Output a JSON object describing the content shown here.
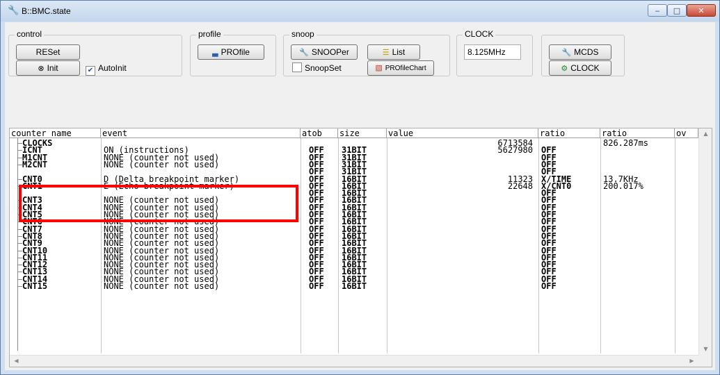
{
  "window": {
    "title": "B::BMC.state",
    "min_glyph": "‒",
    "max_glyph": "□",
    "close_glyph": "✕"
  },
  "control": {
    "label": "control",
    "reset": "RESet",
    "init": "Init",
    "autoinit": "AutoInit",
    "autoinit_checked": true
  },
  "profile": {
    "label": "profile",
    "button": "PROfile"
  },
  "snoop": {
    "label": "snoop",
    "snooper": "SNOOPer",
    "list": "List",
    "snoopset": "SnoopSet",
    "snoopset_checked": false,
    "profilechart": "PROfileChart"
  },
  "clock": {
    "label": "CLOCK",
    "value": "8.125MHz"
  },
  "extra": {
    "mcds": "MCDS",
    "clock_button": "CLOCK"
  },
  "table": {
    "headers": [
      "counter name",
      "event",
      "atob",
      "size",
      "value",
      "ratio",
      "ratio",
      "ov"
    ],
    "rows": [
      {
        "name": "CLOCKS",
        "event": "",
        "atob": "",
        "size": "",
        "value": "6713584",
        "ratio1": "",
        "ratio2": "826.287ms"
      },
      {
        "name": "ICNT",
        "event": "ON (instructions)",
        "atob": "OFF",
        "size": "31BIT",
        "value": "5627980",
        "ratio1": "OFF",
        "ratio2": ""
      },
      {
        "name": "M1CNT",
        "event": "NONE (counter not used)",
        "atob": "OFF",
        "size": "31BIT",
        "value": "",
        "ratio1": "OFF",
        "ratio2": ""
      },
      {
        "name": "M2CNT",
        "event": "NONE (counter not used)",
        "atob": "OFF",
        "size": "31BIT",
        "value": "",
        "ratio1": "OFF",
        "ratio2": ""
      },
      {
        "name": "",
        "event": "",
        "atob": "OFF",
        "size": "31BIT",
        "value": "",
        "ratio1": "OFF",
        "ratio2": ""
      },
      {
        "name": "CNT0",
        "event": "D (Delta breakpoint marker)",
        "atob": "OFF",
        "size": "16BIT",
        "value": "11323",
        "ratio1": "X/TIME",
        "ratio2": "13.7KHz"
      },
      {
        "name": "CNT1",
        "event": "E (Echo breakpoint marker)",
        "atob": "OFF",
        "size": "16BIT",
        "value": "22648",
        "ratio1": "X/CNT0",
        "ratio2": "200.017%"
      },
      {
        "name": "",
        "event": "",
        "atob": "OFF",
        "size": "16BIT",
        "value": "",
        "ratio1": "OFF",
        "ratio2": ""
      },
      {
        "name": "CNT3",
        "event": "NONE (counter not used)",
        "atob": "OFF",
        "size": "16BIT",
        "value": "",
        "ratio1": "OFF",
        "ratio2": ""
      },
      {
        "name": "CNT4",
        "event": "NONE (counter not used)",
        "atob": "OFF",
        "size": "16BIT",
        "value": "",
        "ratio1": "OFF",
        "ratio2": ""
      },
      {
        "name": "CNT5",
        "event": "NONE (counter not used)",
        "atob": "OFF",
        "size": "16BIT",
        "value": "",
        "ratio1": "OFF",
        "ratio2": ""
      },
      {
        "name": "CNT6",
        "event": "NONE (counter not used)",
        "atob": "OFF",
        "size": "16BIT",
        "value": "",
        "ratio1": "OFF",
        "ratio2": ""
      },
      {
        "name": "CNT7",
        "event": "NONE (counter not used)",
        "atob": "OFF",
        "size": "16BIT",
        "value": "",
        "ratio1": "OFF",
        "ratio2": ""
      },
      {
        "name": "CNT8",
        "event": "NONE (counter not used)",
        "atob": "OFF",
        "size": "16BIT",
        "value": "",
        "ratio1": "OFF",
        "ratio2": ""
      },
      {
        "name": "CNT9",
        "event": "NONE (counter not used)",
        "atob": "OFF",
        "size": "16BIT",
        "value": "",
        "ratio1": "OFF",
        "ratio2": ""
      },
      {
        "name": "CNT10",
        "event": "NONE (counter not used)",
        "atob": "OFF",
        "size": "16BIT",
        "value": "",
        "ratio1": "OFF",
        "ratio2": ""
      },
      {
        "name": "CNT11",
        "event": "NONE (counter not used)",
        "atob": "OFF",
        "size": "16BIT",
        "value": "",
        "ratio1": "OFF",
        "ratio2": ""
      },
      {
        "name": "CNT12",
        "event": "NONE (counter not used)",
        "atob": "OFF",
        "size": "16BIT",
        "value": "",
        "ratio1": "OFF",
        "ratio2": ""
      },
      {
        "name": "CNT13",
        "event": "NONE (counter not used)",
        "atob": "OFF",
        "size": "16BIT",
        "value": "",
        "ratio1": "OFF",
        "ratio2": ""
      },
      {
        "name": "CNT14",
        "event": "NONE (counter not used)",
        "atob": "OFF",
        "size": "16BIT",
        "value": "",
        "ratio1": "OFF",
        "ratio2": ""
      },
      {
        "name": "CNT15",
        "event": "NONE (counter not used)",
        "atob": "OFF",
        "size": "16BIT",
        "value": "",
        "ratio1": "OFF",
        "ratio2": ""
      }
    ]
  },
  "colors": {
    "highlight": "#ff0000",
    "title_bg": "#cfdff0",
    "close_red": "#c74a35"
  },
  "icons": {
    "app": "wrench-icon",
    "init": "stop-circle-icon",
    "profile": "bar-chart-icon",
    "snooper": "wrench-icon",
    "list": "list-icon",
    "profilechart": "color-chart-icon",
    "mcds": "wrench-icon",
    "clock": "clock-gear-icon"
  }
}
